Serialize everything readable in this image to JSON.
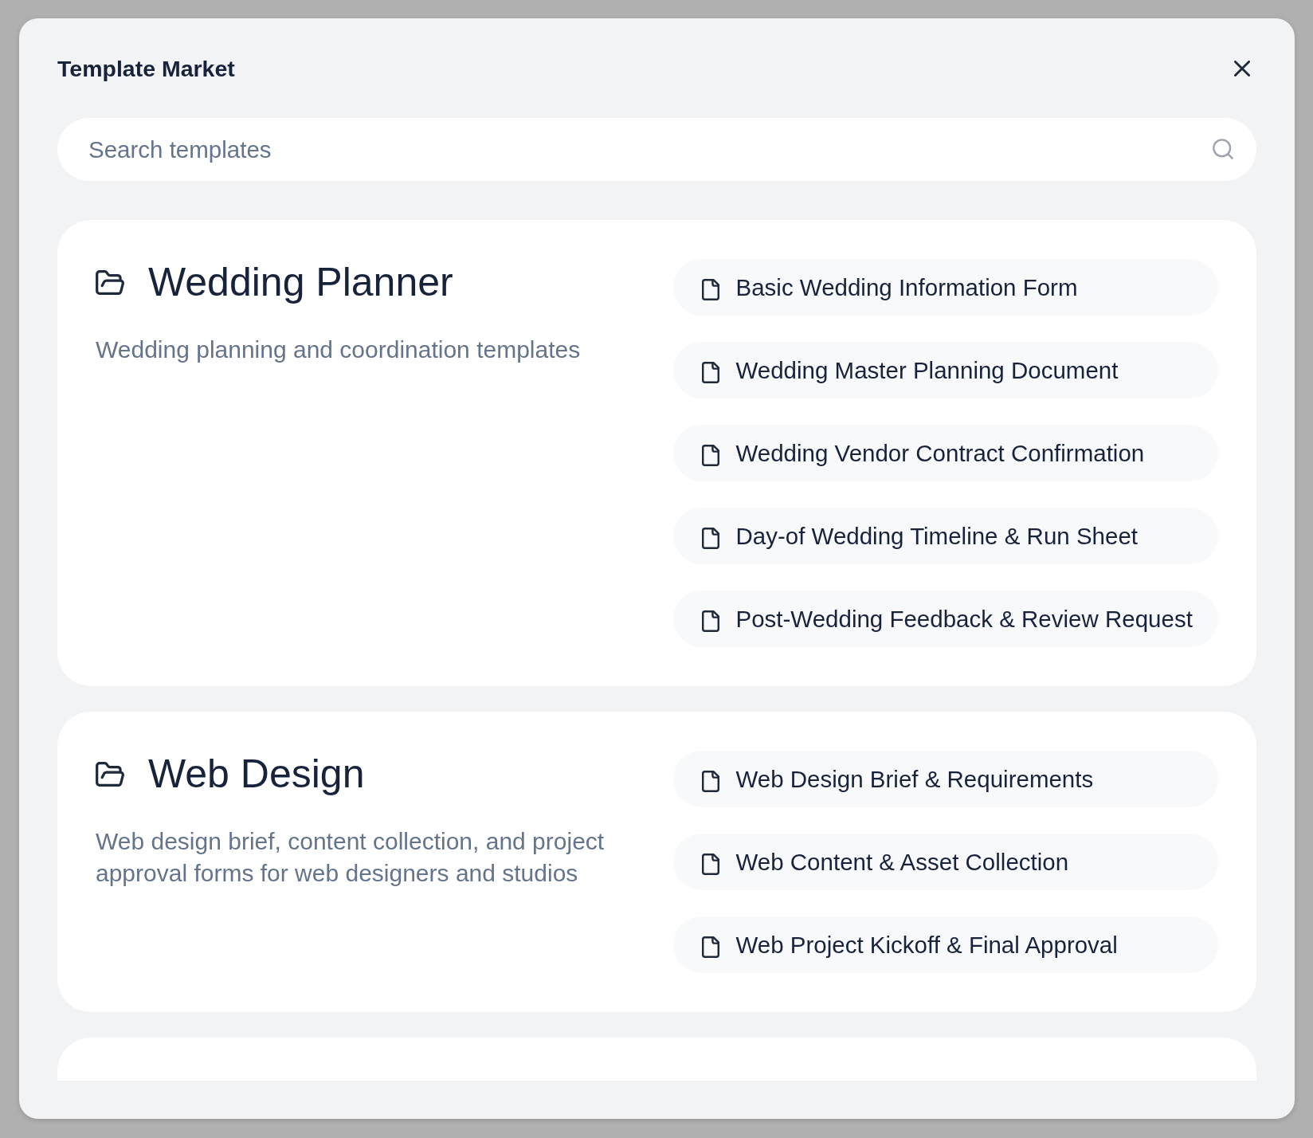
{
  "dialog": {
    "title": "Template Market"
  },
  "search": {
    "placeholder": "Search templates"
  },
  "categories": [
    {
      "name": "Wedding Planner",
      "description": "Wedding planning and coordination templates",
      "templates": [
        "Basic Wedding Information Form",
        "Wedding Master Planning Document",
        "Wedding Vendor Contract Confirmation",
        "Day-of Wedding Timeline & Run Sheet",
        "Post-Wedding Feedback & Review Request"
      ]
    },
    {
      "name": "Web Design",
      "description": "Web design brief, content collection, and project approval forms for web designers and studios",
      "templates": [
        "Web Design Brief & Requirements",
        "Web Content & Asset Collection",
        "Web Project Kickoff & Final Approval"
      ]
    }
  ]
}
